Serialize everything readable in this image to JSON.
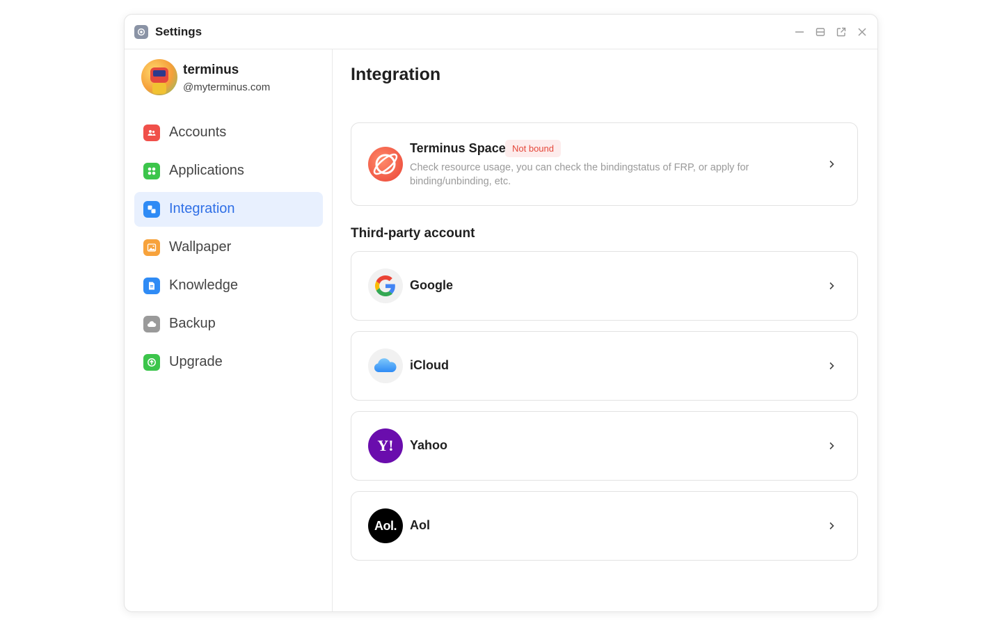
{
  "window": {
    "title": "Settings"
  },
  "profile": {
    "name": "terminus",
    "domain": "@myterminus.com"
  },
  "sidebar": {
    "items": [
      {
        "label": "Accounts",
        "icon": "accounts-icon",
        "color": "#f0504a"
      },
      {
        "label": "Applications",
        "icon": "applications-icon",
        "color": "#3cc54b"
      },
      {
        "label": "Integration",
        "icon": "integration-icon",
        "color": "#2f8bf5",
        "active": true
      },
      {
        "label": "Wallpaper",
        "icon": "wallpaper-icon",
        "color": "#f7a23b"
      },
      {
        "label": "Knowledge",
        "icon": "knowledge-icon",
        "color": "#2f8bf5"
      },
      {
        "label": "Backup",
        "icon": "backup-icon",
        "color": "#9a9a9a"
      },
      {
        "label": "Upgrade",
        "icon": "upgrade-icon",
        "color": "#3cc54b"
      }
    ]
  },
  "main": {
    "title": "Integration",
    "space": {
      "name": "Terminus Space",
      "badge": "Not bound",
      "description": "Check resource usage, you can check the bindingstatus of FRP, or apply for binding/unbinding, etc."
    },
    "third_party_title": "Third-party account",
    "accounts": [
      {
        "name": "Google",
        "icon": "google-icon"
      },
      {
        "name": "iCloud",
        "icon": "icloud-icon"
      },
      {
        "name": "Yahoo",
        "icon": "yahoo-icon",
        "logo_text": "Y!"
      },
      {
        "name": "Aol",
        "icon": "aol-icon",
        "logo_text": "Aol."
      }
    ]
  },
  "colors": {
    "accent": "#2f6fe6",
    "badge_bg": "#fdecec",
    "badge_text": "#e5483a",
    "active_bg": "#e8f0fe"
  }
}
